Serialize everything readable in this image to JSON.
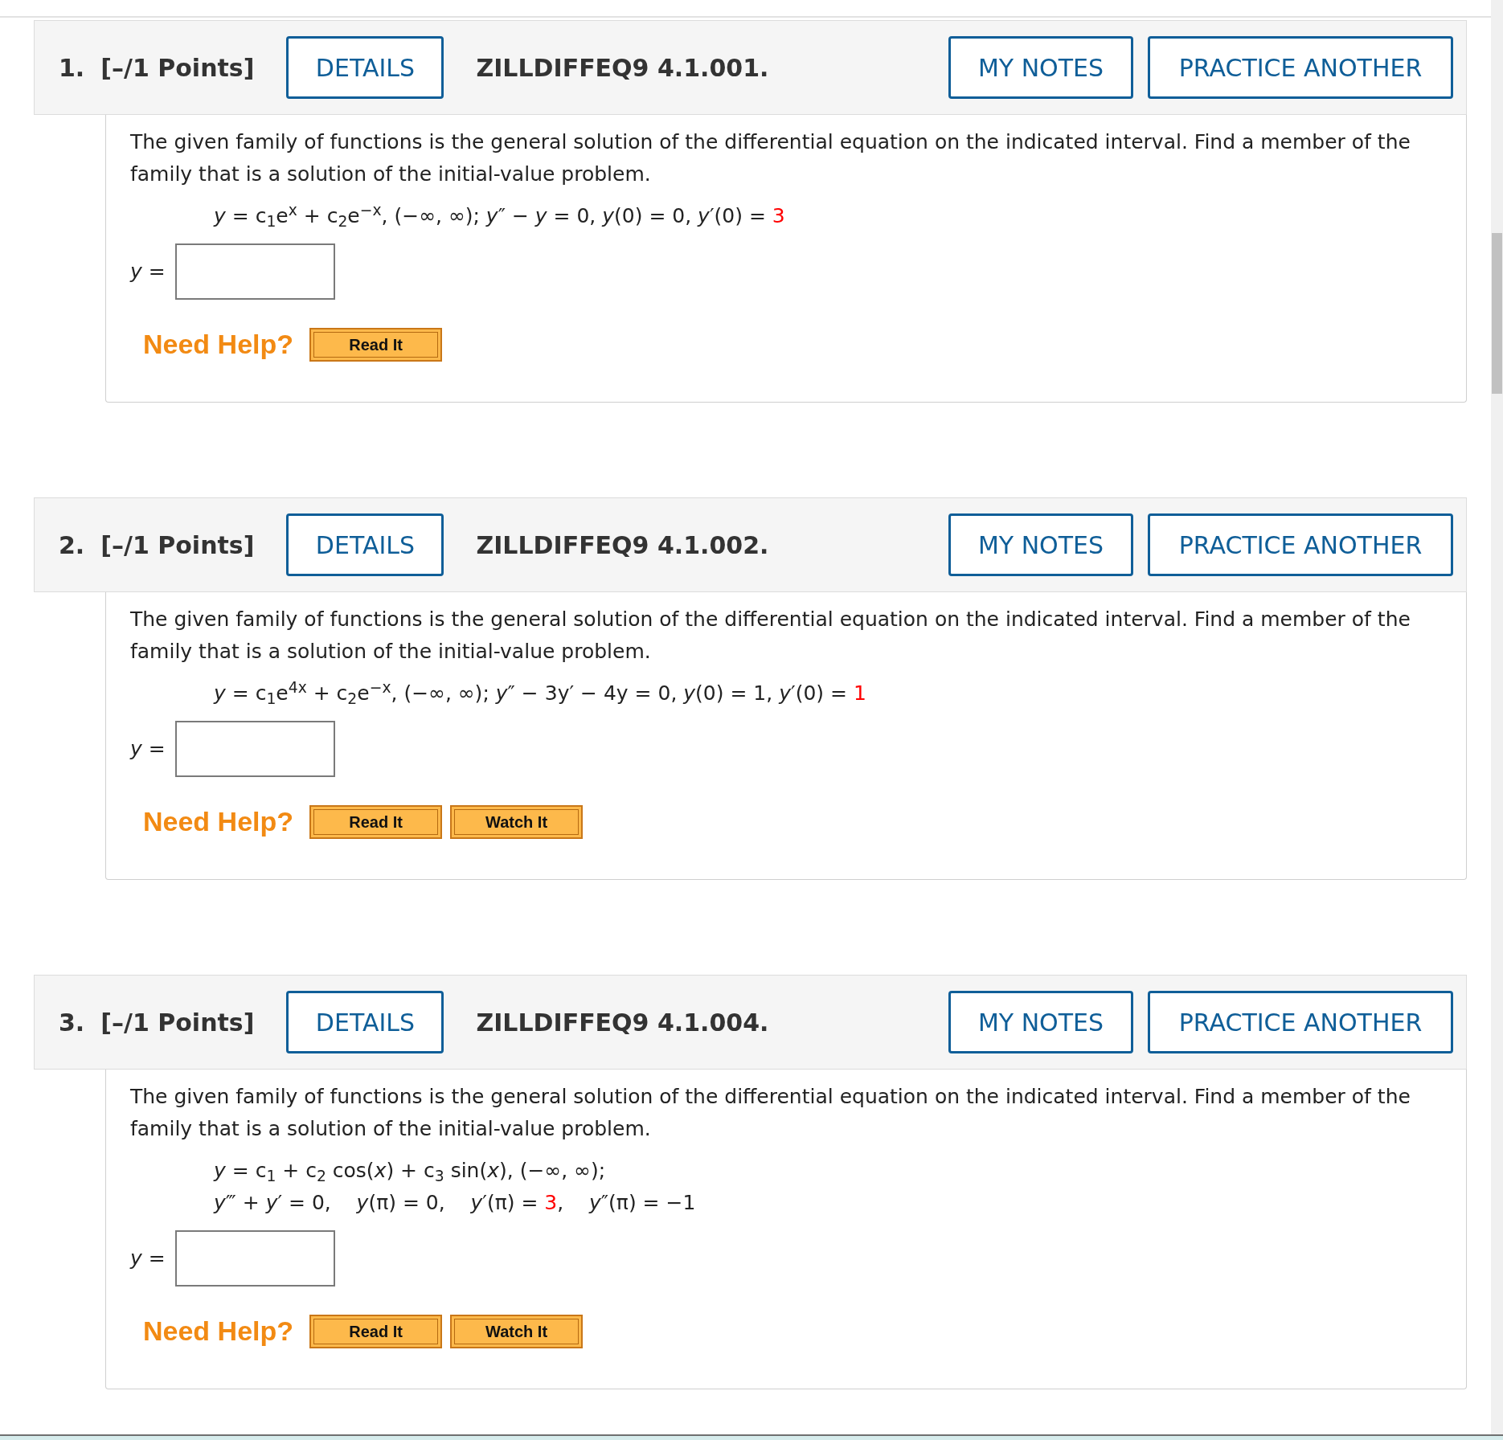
{
  "questions": [
    {
      "number": "1.",
      "points": "[–/1 Points]",
      "details": "DETAILS",
      "code": "ZILLDIFFEQ9 4.1.001.",
      "my_notes": "MY NOTES",
      "practice": "PRACTICE ANOTHER",
      "prompt": "The given family of functions is the general solution of the differential equation on the indicated interval. Find a member of the family that is a solution of the initial-value problem.",
      "equation_lines": [
        [
          {
            "text": "*y* = c$_{1}$e$^{x}$ + c$_{2}$e$^{−x}$, (−∞, ∞); *y*″ − *y* = 0, *y*(0) = 0, *y*′(0) = ",
            "highlight": false
          },
          {
            "text": "3",
            "highlight": true
          }
        ]
      ],
      "answer_label": "*y* =",
      "need_help": "Need Help?",
      "help_buttons": [
        "Read It"
      ]
    },
    {
      "number": "2.",
      "points": "[–/1 Points]",
      "details": "DETAILS",
      "code": "ZILLDIFFEQ9 4.1.002.",
      "my_notes": "MY NOTES",
      "practice": "PRACTICE ANOTHER",
      "prompt": "The given family of functions is the general solution of the differential equation on the indicated interval. Find a member of the family that is a solution of the initial-value problem.",
      "equation_lines": [
        [
          {
            "text": "*y* = c$_{1}$e$^{4x}$ + c$_{2}$e$^{−x}$, (−∞, ∞); *y*″ − 3y′ − 4y = 0, *y*(0) = 1, *y*′(0) = ",
            "highlight": false
          },
          {
            "text": "1",
            "highlight": true
          }
        ]
      ],
      "answer_label": "*y* =",
      "need_help": "Need Help?",
      "help_buttons": [
        "Read It",
        "Watch It"
      ]
    },
    {
      "number": "3.",
      "points": "[–/1 Points]",
      "details": "DETAILS",
      "code": "ZILLDIFFEQ9 4.1.004.",
      "my_notes": "MY NOTES",
      "practice": "PRACTICE ANOTHER",
      "prompt": "The given family of functions is the general solution of the differential equation on the indicated interval. Find a member of the family that is a solution of the initial-value problem.",
      "equation_lines": [
        [
          {
            "text": "*y* = c$_{1}$ + c$_{2}$ cos(*x*) + c$_{3}$ sin(*x*), (−∞, ∞);",
            "highlight": false
          }
        ],
        [
          {
            "text": "*y*‴ + *y*′ = 0,    *y*(π) = 0,    *y*′(π) = ",
            "highlight": false
          },
          {
            "text": "3",
            "highlight": true
          },
          {
            "text": ",    *y*″(π) = −1",
            "highlight": false
          }
        ]
      ],
      "answer_label": "*y* =",
      "need_help": "Need Help?",
      "help_buttons": [
        "Read It",
        "Watch It"
      ]
    }
  ]
}
